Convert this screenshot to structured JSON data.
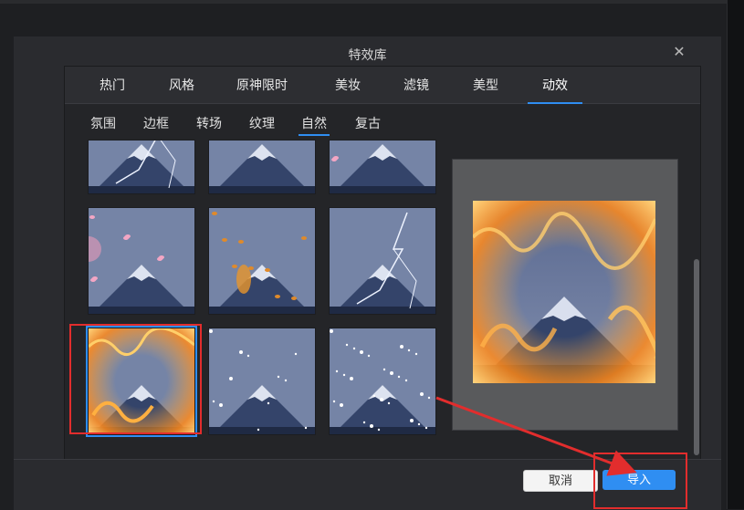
{
  "dialog": {
    "title": "特效库",
    "close_icon": "close-icon"
  },
  "tabs": [
    {
      "label": "热门"
    },
    {
      "label": "风格"
    },
    {
      "label": "原神限时"
    },
    {
      "label": "美妆"
    },
    {
      "label": "滤镜"
    },
    {
      "label": "美型"
    },
    {
      "label": "动效",
      "active": true
    }
  ],
  "subtabs": [
    {
      "label": "氛围"
    },
    {
      "label": "边框"
    },
    {
      "label": "转场"
    },
    {
      "label": "纹理"
    },
    {
      "label": "自然",
      "active": true
    },
    {
      "label": "复古"
    }
  ],
  "effects": [
    {
      "name": "rain-lightning-light"
    },
    {
      "name": "plain"
    },
    {
      "name": "petals-light"
    },
    {
      "name": "cherry-blossom-petals"
    },
    {
      "name": "falling-leaves"
    },
    {
      "name": "lightning"
    },
    {
      "name": "fire",
      "selected": true
    },
    {
      "name": "snow"
    },
    {
      "name": "heavy-snow"
    }
  ],
  "footer": {
    "cancel_label": "取消",
    "import_label": "导入"
  },
  "colors": {
    "accent": "#2f8ef2",
    "annotation": "#e22d2d"
  }
}
